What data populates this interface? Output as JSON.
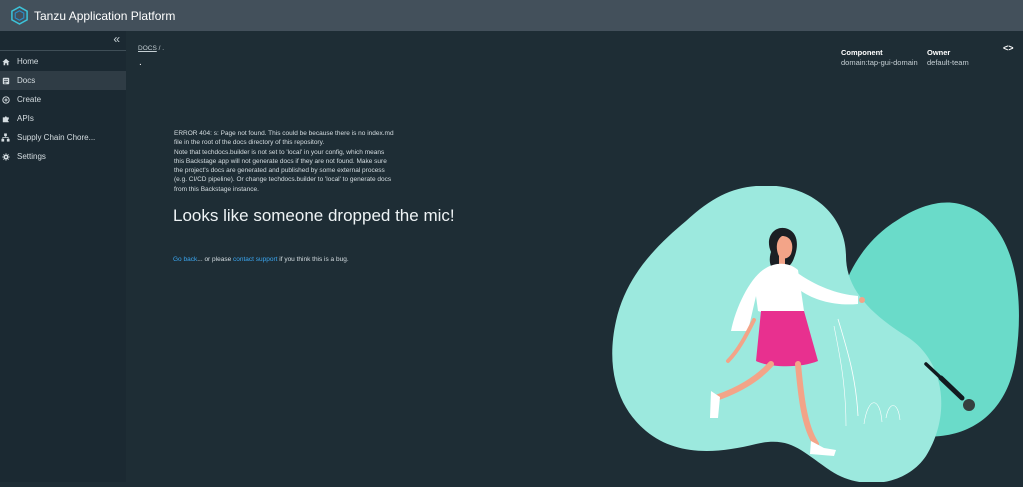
{
  "app": {
    "title": "Tanzu Application Platform"
  },
  "sidebar": {
    "collapse_label": "«",
    "items": [
      {
        "label": "Home",
        "icon": "home-icon"
      },
      {
        "label": "Docs",
        "icon": "docs-icon"
      },
      {
        "label": "Create",
        "icon": "create-icon"
      },
      {
        "label": "APIs",
        "icon": "puzzle-icon"
      },
      {
        "label": "Supply Chain Chore...",
        "icon": "supply-chain-icon"
      },
      {
        "label": "Settings",
        "icon": "gear-icon"
      }
    ]
  },
  "breadcrumb": {
    "root": "DOCS",
    "separator": "/",
    "current": "."
  },
  "page": {
    "title": "."
  },
  "meta": {
    "component_label": "Component",
    "component_value": "domain:tap-gui-domain",
    "owner_label": "Owner",
    "owner_value": "default-team",
    "toggle_label": "<>"
  },
  "error": {
    "lines": [
      "ERROR 404: s: Page not found. This could be because there is no index.md",
      "file in the root of the docs directory of this repository.",
      "Note that techdocs.builder is not set to 'local' in your config, which means",
      "this Backstage app will not generate docs if they are not found. Make sure",
      "the project's docs are generated and published by some external process",
      "(e.g. CI/CD pipeline). Or change techdocs.builder to 'local' to generate docs",
      "from this Backstage instance."
    ],
    "headline": "Looks like someone dropped the mic!",
    "go_back": "Go back",
    "middle": "... or please ",
    "contact": "contact support",
    "tail": " if you think this is a bug."
  },
  "colors": {
    "topbar": "#43505b",
    "sidebar": "#1b2932",
    "main_bg": "#1e2d35",
    "link": "#3aa6f0",
    "illustration_blob": "#66dcc8",
    "skirt": "#e8308f"
  }
}
